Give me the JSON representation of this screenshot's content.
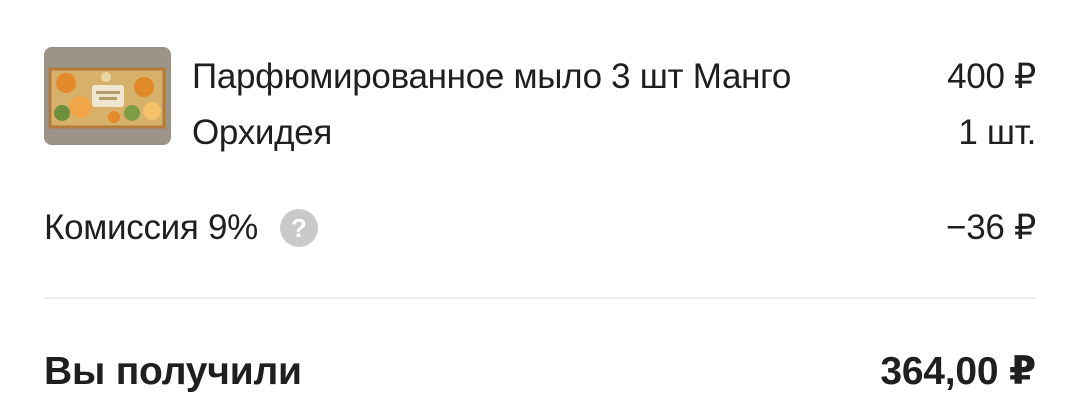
{
  "order_item": {
    "image_icon": "product-thumbnail-soap-box",
    "name": "Парфюмированное мыло 3 шт Манго Орхидея",
    "price": "400 ₽",
    "quantity": "1 шт."
  },
  "commission": {
    "label": "Комиссия 9%",
    "help_icon": "question-circle-icon",
    "help_glyph": "?",
    "value": "−36 ₽"
  },
  "summary": {
    "label": "Вы получили",
    "value": "364,00 ₽"
  },
  "colors": {
    "text": "#1f1f1f",
    "help_icon_bg": "#c9c9c9",
    "divider": "#ececec"
  }
}
